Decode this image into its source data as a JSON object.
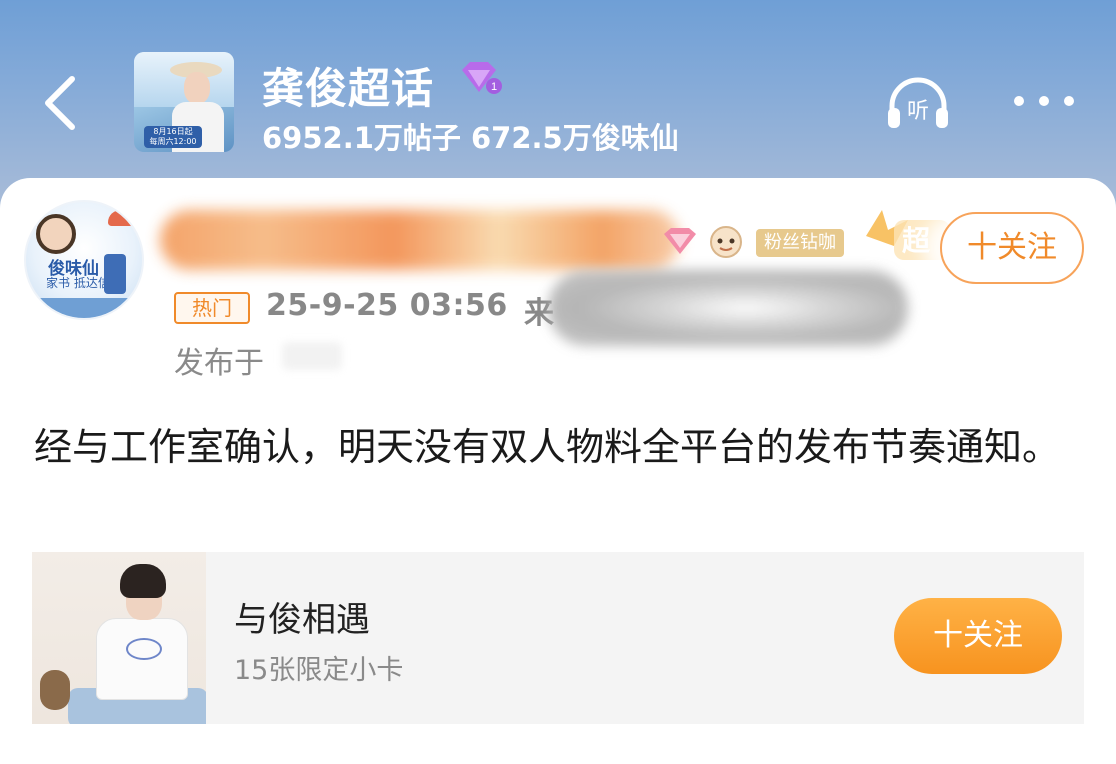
{
  "header": {
    "back_icon": "chevron-left-icon",
    "topic_title": "龚俊超话",
    "topic_stats": "6952.1万帖子 672.5万俊味仙",
    "cover_badge": "8月16日起",
    "cover_badge_sub": "每周六12:00",
    "level": "1",
    "listen_label": "听",
    "more_icon": "more-dots-icon"
  },
  "post": {
    "author_avatar_text": "俊味仙",
    "author_avatar_sub": "家书\n抵达信箱",
    "fan_badge": "粉丝钻咖",
    "super_badge": "超",
    "follow_label": "十关注",
    "hot_tag": "热门",
    "time": "25-9-25 03:56",
    "source_prefix": "来",
    "publish_at": "发布于",
    "text": "经与工作室确认，明天没有双人物料全平台的发布节奏通知。"
  },
  "product": {
    "name": "与俊相遇",
    "desc": "15张限定小卡",
    "follow_label": "十关注"
  },
  "colors": {
    "accent": "#f08a2a",
    "header_top": "#6f9fd6",
    "fan_badge": "#e7c98d"
  }
}
